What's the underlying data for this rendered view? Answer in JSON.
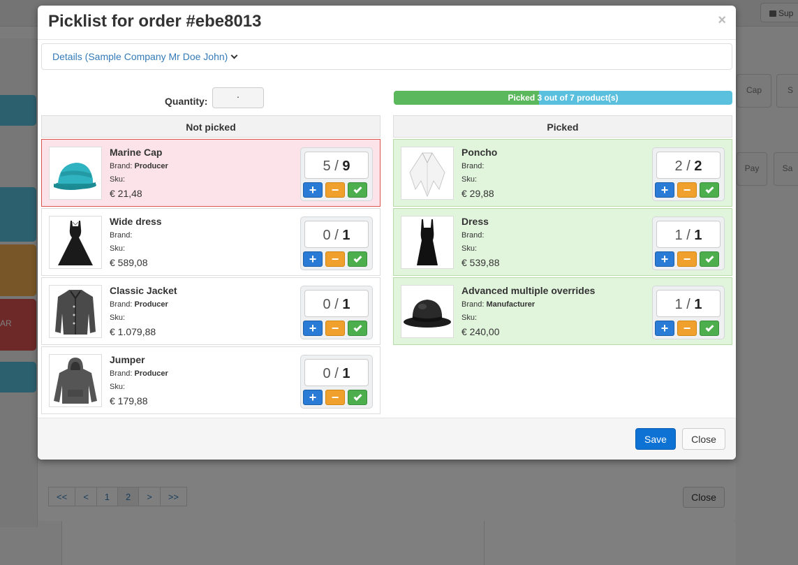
{
  "background": {
    "support_label": "Sup",
    "tile_label": "AR",
    "right_buttons": [
      "Cap",
      "S",
      "Pay",
      "Sa"
    ],
    "pager": [
      "<<",
      "<",
      "1",
      "2",
      ">",
      ">>"
    ],
    "close_label": "Close"
  },
  "modal": {
    "title": "Picklist for order #ebe8013",
    "details_link": "Details (Sample Company Mr Doe John)",
    "quantity_label": "Quantity:",
    "quantity_value": "·",
    "progress": {
      "picked": 3,
      "total": 7,
      "text": "Picked 3 out of 7 product(s)"
    },
    "not_picked": {
      "heading": "Not picked",
      "items": [
        {
          "name": "Marine Cap",
          "brand_label": "Brand:",
          "brand": "Producer",
          "sku_label": "Sku:",
          "price": "€ 21,48",
          "picked": "5",
          "total": "9",
          "highlight": "red",
          "icon": "marine-cap-image"
        },
        {
          "name": "Wide dress",
          "brand_label": "Brand:",
          "brand": "",
          "sku_label": "Sku:",
          "price": "€ 589,08",
          "picked": "0",
          "total": "1",
          "highlight": "none",
          "icon": "wide-dress-image"
        },
        {
          "name": "Classic Jacket",
          "brand_label": "Brand:",
          "brand": "Producer",
          "sku_label": "Sku:",
          "price": "€ 1.079,88",
          "picked": "0",
          "total": "1",
          "highlight": "none",
          "icon": "jacket-image"
        },
        {
          "name": "Jumper",
          "brand_label": "Brand:",
          "brand": "Producer",
          "sku_label": "Sku:",
          "price": "€ 179,88",
          "picked": "0",
          "total": "1",
          "highlight": "none",
          "icon": "hoodie-image"
        }
      ]
    },
    "picked": {
      "heading": "Picked",
      "items": [
        {
          "name": "Poncho",
          "brand_label": "Brand:",
          "brand": "",
          "sku_label": "Sku:",
          "price": "€ 29,88",
          "picked": "2",
          "total": "2",
          "highlight": "green",
          "icon": "poncho-image"
        },
        {
          "name": "Dress",
          "brand_label": "Brand:",
          "brand": "",
          "sku_label": "Sku:",
          "price": "€ 539,88",
          "picked": "1",
          "total": "1",
          "highlight": "green",
          "icon": "dress-image"
        },
        {
          "name": "Advanced multiple overrides",
          "brand_label": "Brand:",
          "brand": "Manufacturer",
          "sku_label": "Sku:",
          "price": "€ 240,00",
          "picked": "1",
          "total": "1",
          "highlight": "green",
          "icon": "bowler-hat-image"
        }
      ]
    },
    "counter_separator": "/",
    "buttons": {
      "plus": "+",
      "minus": "−",
      "save": "Save",
      "close": "Close",
      "x": "×"
    }
  },
  "colors": {
    "not_picked_highlight": "#fce3ea",
    "picked_highlight": "#e1f4dc",
    "progress_green": "#5cb85c",
    "progress_blue": "#5bc0de",
    "save_button": "#0e72d4"
  }
}
